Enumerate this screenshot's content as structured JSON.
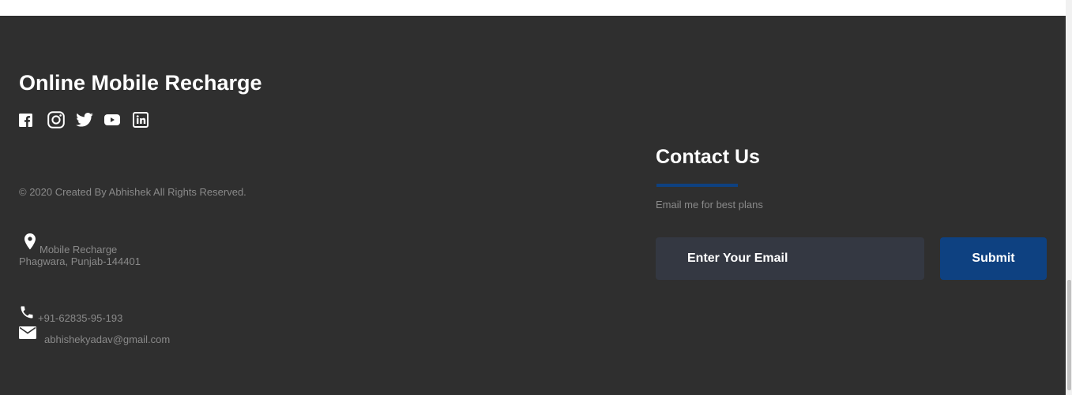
{
  "brand": {
    "title": "Online Mobile Recharge"
  },
  "social": [
    {
      "name": "facebook-icon"
    },
    {
      "name": "instagram-icon"
    },
    {
      "name": "twitter-icon"
    },
    {
      "name": "youtube-icon"
    },
    {
      "name": "linkedin-icon"
    }
  ],
  "footer": {
    "copyright": "© 2020 Created By Abhishek All Rights Reserved.",
    "address_line1": "Mobile Recharge",
    "address_line2": "Phagwara, Punjab-144401",
    "phone": "+91-62835-95-193",
    "email": "abhishekyadav@gmail.com"
  },
  "contact": {
    "title": "Contact Us",
    "subtitle": "Email me for best plans",
    "email_placeholder": "Enter Your Email",
    "submit_label": "Submit"
  },
  "colors": {
    "footer_bg": "#2f2f2f",
    "accent": "#0e4181",
    "input_bg": "#343842",
    "muted_text": "#8a8a8a"
  }
}
